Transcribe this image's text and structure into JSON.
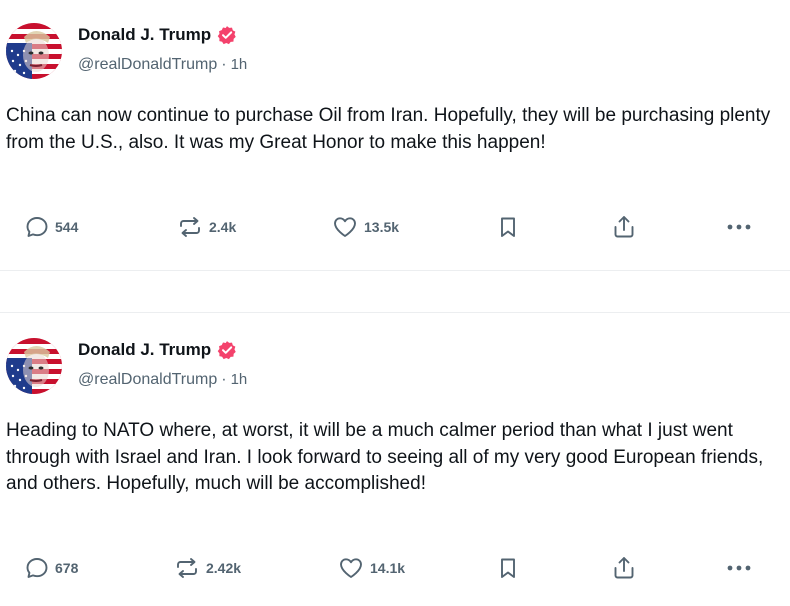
{
  "colors": {
    "text_primary": "#0f1419",
    "text_secondary": "#536471",
    "verified_badge": "#f4426c",
    "divider": "#eceef0"
  },
  "icons": {
    "reply": "speech-bubble",
    "repost": "two-arrows-loop",
    "like": "heart-outline",
    "bookmark": "bookmark-outline",
    "share": "upload-arrow",
    "more": "three-dots"
  },
  "posts": [
    {
      "author": {
        "display_name": "Donald J. Trump",
        "handle": "@realDonaldTrump",
        "verified": true
      },
      "separator": "·",
      "time": "1h",
      "text": "China can now continue to purchase Oil from Iran. Hopefully, they will be purchasing plenty from the U.S., also. It was my Great Honor to make this happen!",
      "stats": {
        "replies": "544",
        "reposts": "2.4k",
        "likes": "13.5k"
      }
    },
    {
      "author": {
        "display_name": "Donald J. Trump",
        "handle": "@realDonaldTrump",
        "verified": true
      },
      "separator": "·",
      "time": "1h",
      "text": "Heading to NATO where, at worst, it will be a much calmer period than what I just went through with Israel and Iran. I look forward to seeing all of my very good European friends, and others. Hopefully, much will be accomplished!",
      "stats": {
        "replies": "678",
        "reposts": "2.42k",
        "likes": "14.1k"
      }
    }
  ]
}
